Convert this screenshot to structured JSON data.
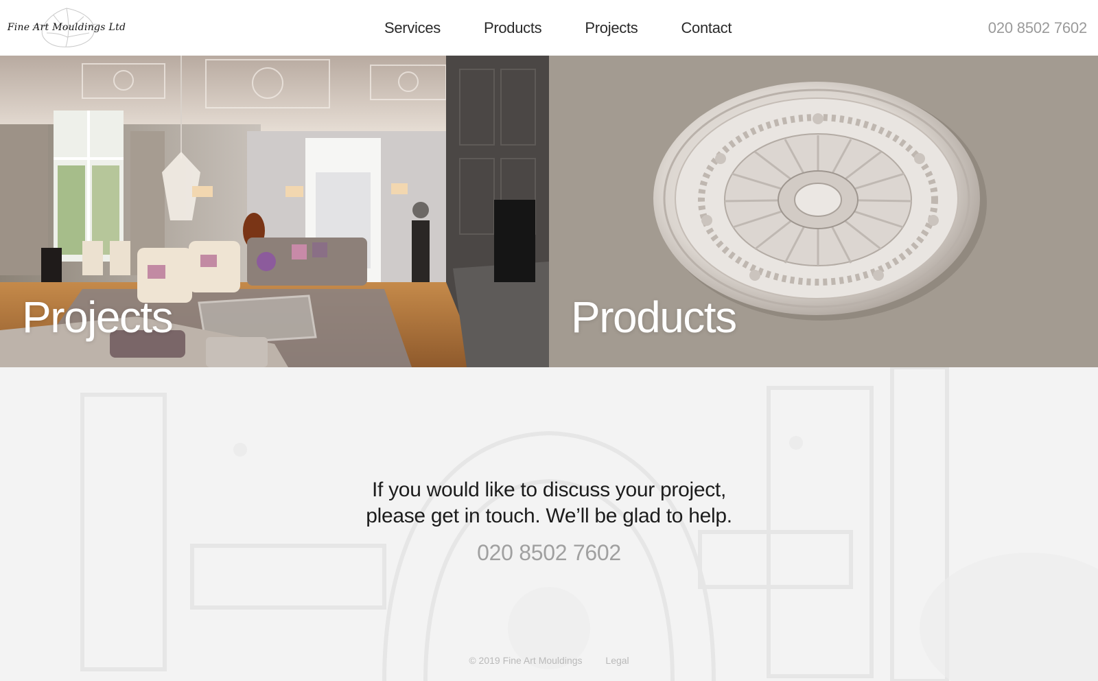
{
  "header": {
    "logo_text": "Fine Art Mouldings Ltd",
    "nav": [
      "Services",
      "Products",
      "Projects",
      "Contact"
    ],
    "phone": "020 8502 7602"
  },
  "panels": {
    "projects_label": "Projects",
    "products_label": "Products"
  },
  "contact": {
    "line1": "If you would like to discuss your project,",
    "line2": "please get in touch. We’ll be glad to help.",
    "phone": "020 8502 7602"
  },
  "footer": {
    "copyright": "© 2019 Fine Art Mouldings",
    "legal": "Legal"
  },
  "colors": {
    "products_bg": "#a39b91",
    "phone_grey": "#9a9a9a",
    "contact_bg": "#f3f3f3"
  }
}
